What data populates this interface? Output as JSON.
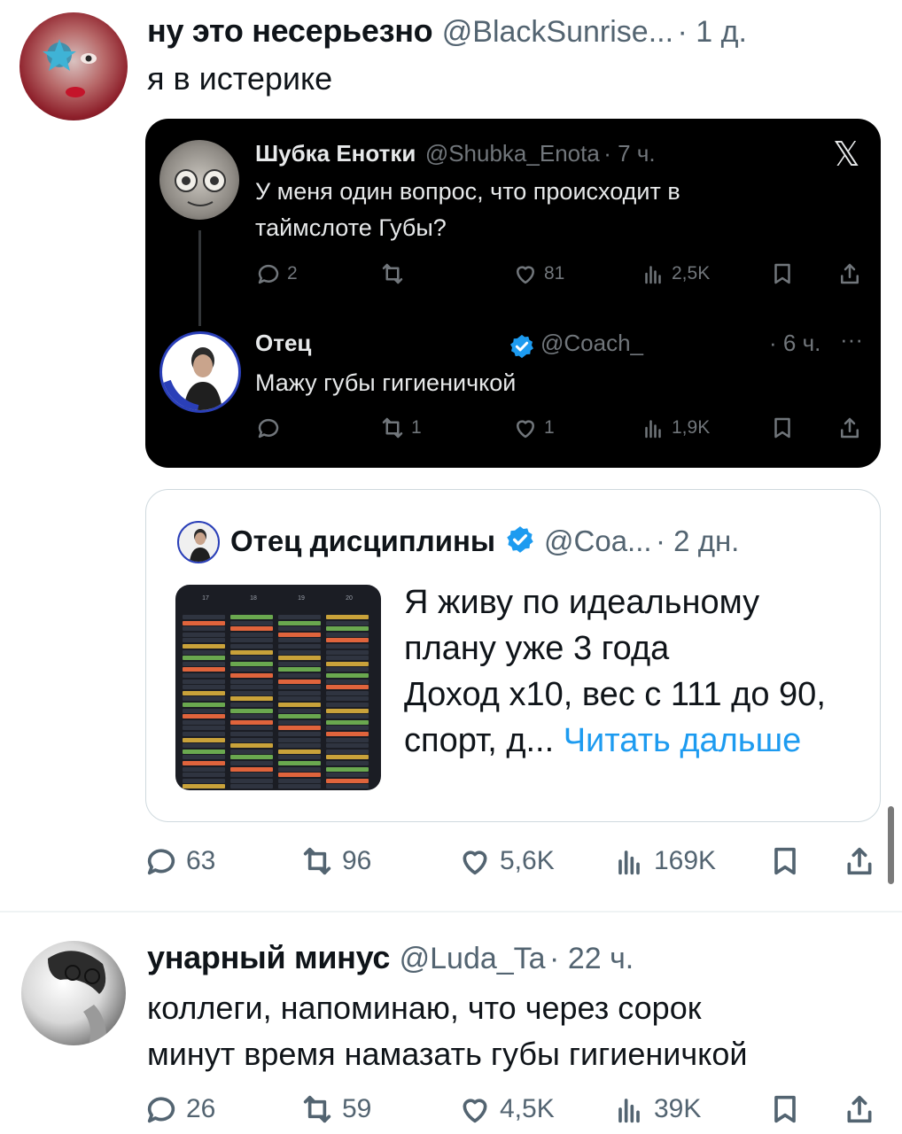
{
  "tweet1": {
    "name": "ну это несерьезно",
    "handle": "@BlackSunrise...",
    "time": "· 1 д.",
    "text": "я в истерике",
    "stats": {
      "replies": "63",
      "retweets": "96",
      "likes": "5,6K",
      "views": "169K"
    }
  },
  "dark_card": {
    "t1": {
      "name": "Шубка Енотки",
      "handle": "@Shubka_Enota",
      "time": "· 7 ч.",
      "text1": "У меня один вопрос, что происходит в",
      "text2": "таймслоте Губы?",
      "stats": {
        "replies": "2",
        "retweets": "",
        "likes": "81",
        "views": "2,5K"
      }
    },
    "t2": {
      "name": "Отец",
      "handle": "@Coach_",
      "time": "· 6 ч.",
      "more": "···",
      "text": "Мажу губы гигиеничкой",
      "stats": {
        "replies": "",
        "retweets": "1",
        "likes": "1",
        "views": "1,9K"
      }
    },
    "x_logo": "𝕏"
  },
  "quote": {
    "name": "Отец дисциплины",
    "handle": "@Coa...",
    "time": "· 2 дн.",
    "line1": "Я живу по идеальному",
    "line2": "плану уже 3 года",
    "line3": "Доход x10, вес с 111 до 90,",
    "line4_prefix": "спорт, д... ",
    "read_more": "Читать дальше",
    "cal_days": [
      "17",
      "18",
      "19",
      "20"
    ]
  },
  "tweet2": {
    "name": "унарный минус",
    "handle": "@Luda_Ta",
    "time": "· 22 ч.",
    "text1": "коллеги, напоминаю, что через сорок",
    "text2": "минут время намазать губы гигиеничкой",
    "stats": {
      "replies": "26",
      "retweets": "59",
      "likes": "4,5K",
      "views": "39K"
    }
  },
  "colors": {
    "link": "#1d9bf0",
    "verified": "#1d9bf0",
    "muted": "#536471",
    "dark_bg": "#000000"
  }
}
